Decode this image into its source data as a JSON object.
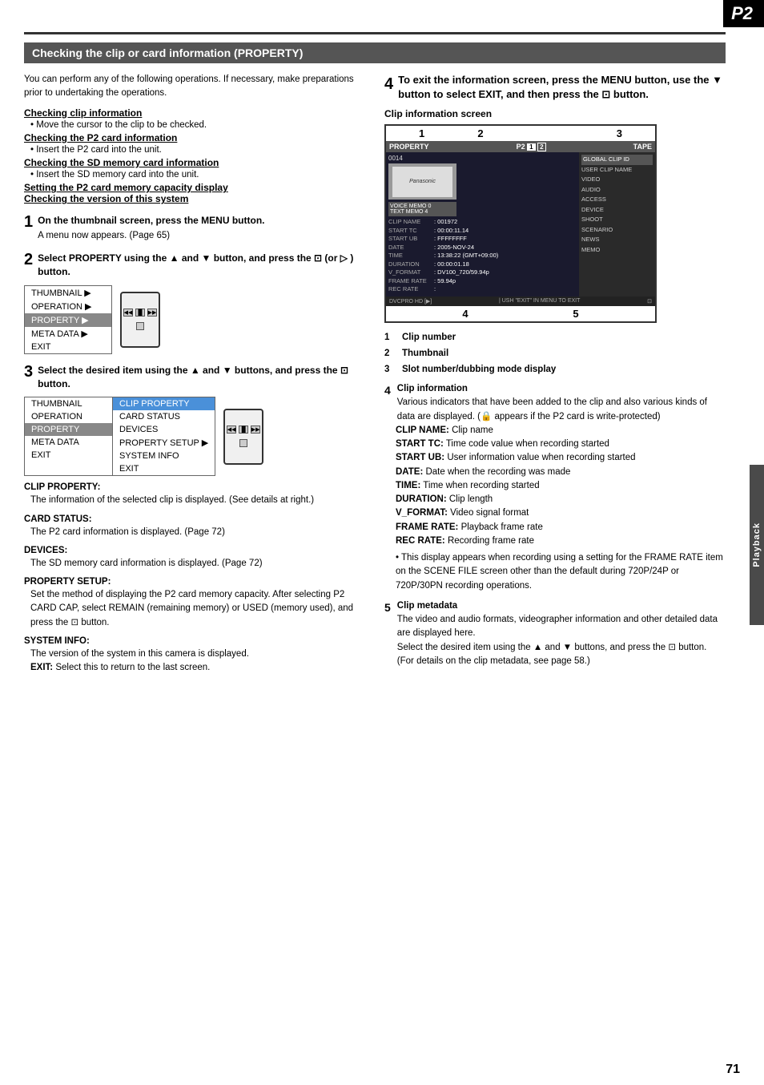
{
  "badge": {
    "label": "P2"
  },
  "sidebar": {
    "label": "Playback"
  },
  "page_number": "71",
  "header": {
    "title": "Checking the clip or card information (PROPERTY)"
  },
  "intro": {
    "text": "You can perform any of the following operations. If necessary, make preparations prior to undertaking the operations.",
    "items": [
      {
        "heading": "Checking clip information",
        "text": "Move the cursor to the clip to be checked."
      },
      {
        "heading": "Checking the P2 card information",
        "text": "Insert the P2 card into the unit."
      },
      {
        "heading": "Checking the SD memory card information",
        "text": "Insert the SD memory card into the unit."
      },
      {
        "heading": "Setting the P2 card memory capacity display",
        "text": ""
      },
      {
        "heading": "Checking the version of this system",
        "text": ""
      }
    ]
  },
  "steps": [
    {
      "num": "1",
      "text": "On the thumbnail screen, press the MENU button.",
      "subtext": "A menu now appears. (Page 65)"
    },
    {
      "num": "2",
      "text": "Select PROPERTY using the ▲ and ▼ button, and press the ⊡ (or ▷ ) button.",
      "menu": {
        "items": [
          "THUMBNAIL ▶",
          "OPERATION ▶",
          "PROPERTY ▶",
          "META DATA ▶",
          "EXIT"
        ],
        "selected": 2
      }
    },
    {
      "num": "3",
      "text": "Select the desired item using the ▲ and ▼ buttons, and press the ⊡ button.",
      "mainMenu": {
        "items": [
          "THUMBNAIL",
          "OPERATION",
          "PROPERTY",
          "META DATA",
          "EXIT"
        ],
        "selected": 2
      },
      "subMenu": {
        "items": [
          "CLIP PROPERTY",
          "CARD STATUS",
          "DEVICES",
          "PROPERTY SETUP ▶",
          "SYSTEM INFO",
          "EXIT"
        ],
        "selected": 0
      }
    }
  ],
  "step3_sections": [
    {
      "heading": "CLIP PROPERTY:",
      "body": "The information of the selected clip is displayed. (See details at right.)"
    },
    {
      "heading": "CARD STATUS:",
      "body": "The P2 card information is displayed. (Page 72)"
    },
    {
      "heading": "DEVICES:",
      "body": "The SD memory card information is displayed. (Page 72)"
    },
    {
      "heading": "PROPERTY SETUP:",
      "body": "Set the method of displaying the P2 card memory capacity. After selecting P2 CARD CAP, select REMAIN (remaining memory) or USED (memory used), and press the ⊡ button."
    },
    {
      "heading": "SYSTEM INFO:",
      "body": "The version of the system in this camera is displayed."
    },
    {
      "heading": "EXIT:",
      "body": "Select this to return to the last screen."
    }
  ],
  "step4": {
    "num": "4",
    "text": "To exit the information screen, press the MENU button, use the ▼ button to select EXIT, and then press the ⊡ button."
  },
  "clip_info_screen": {
    "label": "Clip information screen",
    "numbers": [
      "1",
      "2",
      "3"
    ],
    "numbers_bottom": [
      "4",
      "5"
    ],
    "screen": {
      "top_bar": {
        "left": "PROPERTY",
        "mid": "P2 1 2",
        "right": "TAPE"
      },
      "clip_num": "0014",
      "brand": "Panasonic",
      "memo_items": [
        "VOICE MEMO  0",
        "TEXT MEMO   4"
      ],
      "data_rows": [
        {
          "key": "CLIP NAME",
          "val": ": 001972"
        },
        {
          "key": "START TC",
          "val": ": 00:00:11.14"
        },
        {
          "key": "START UB",
          "val": ": FFFFFFFF"
        },
        {
          "key": "DATE",
          "val": ": 2005-NOV-24"
        },
        {
          "key": "TIME",
          "val": ": 13:38:22 (GMT+09:00)"
        },
        {
          "key": "DURATION",
          "val": ": 00:00:01.18"
        },
        {
          "key": "V_FORMAT",
          "val": ": DV100_720/59.94p"
        },
        {
          "key": "FRAME RATE",
          "val": ": 59.94p"
        },
        {
          "key": "REC RATE",
          "val": ":"
        }
      ],
      "right_items": [
        {
          "label": "GLOBAL CLIP ID",
          "active": false
        },
        {
          "label": "USER CLIP NAME",
          "active": false
        },
        {
          "label": "VIDEO",
          "active": false
        },
        {
          "label": "AUDIO",
          "active": false
        },
        {
          "label": "ACCESS",
          "active": false
        },
        {
          "label": "DEVICE",
          "active": false
        },
        {
          "label": "SHOOT",
          "active": false
        },
        {
          "label": "SCENARIO",
          "active": false
        },
        {
          "label": "NEWS",
          "active": false
        },
        {
          "label": "MEMO",
          "active": false
        }
      ],
      "bottom_bar_left": "DVCPRO HD",
      "bottom_bar_right": "USH \"EXIT\" IN MENU TO EXIT"
    }
  },
  "numbered_items": [
    {
      "num": "1",
      "label": "Clip number"
    },
    {
      "num": "2",
      "label": "Thumbnail"
    },
    {
      "num": "3",
      "label": "Slot number/dubbing mode display"
    }
  ],
  "clip_info_detail": {
    "num": "4",
    "label": "Clip information",
    "body": "Various indicators that have been added to the clip and also various kinds of data are displayed. (🔒 appears if the P2 card is write-protected)",
    "sub_items": [
      {
        "label": "CLIP NAME:",
        "text": "Clip name"
      },
      {
        "label": "START TC:",
        "text": "Time code value when recording started"
      },
      {
        "label": "START UB:",
        "text": "User information value when recording started"
      },
      {
        "label": "DATE:",
        "text": "Date when the recording was made"
      },
      {
        "label": "TIME:",
        "text": "Time when recording started"
      },
      {
        "label": "DURATION:",
        "text": "Clip length"
      },
      {
        "label": "V_FORMAT:",
        "text": "Video signal format"
      },
      {
        "label": "FRAME RATE:",
        "text": "Playback frame rate"
      },
      {
        "label": "REC RATE:",
        "text": "Recording frame rate"
      }
    ],
    "note": "• This display appears when recording using a setting for the FRAME RATE item on the SCENE FILE screen other than the default during 720P/24P or 720P/30PN recording operations."
  },
  "clip_metadata": {
    "num": "5",
    "label": "Clip metadata",
    "body": "The video and audio formats, videographer information and other detailed data are displayed here.",
    "note": "Select the desired item using the ▲ and ▼ buttons, and press the ⊡ button. (For details on the clip metadata, see page 58.)"
  }
}
